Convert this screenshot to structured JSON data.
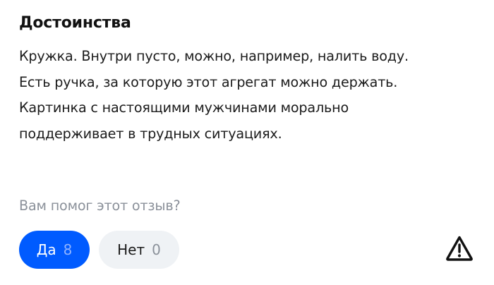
{
  "review": {
    "section_title": "Достоинства",
    "text_lines": [
      "Кружка. Внутри пусто, можно, например, налить воду.",
      "Есть ручка, за которую этот агрегат можно держать.",
      "Картинка с настоящими мужчинами морально",
      "поддерживает в трудных ситуациях."
    ]
  },
  "helpful": {
    "question": "Вам помог этот отзыв?",
    "yes_label": "Да",
    "yes_count": "8",
    "no_label": "Нет",
    "no_count": "0"
  },
  "icons": {
    "report": "warning-triangle-icon"
  },
  "colors": {
    "accent": "#005bff",
    "muted_text": "#8b919a",
    "secondary_button_bg": "#eff2f5"
  }
}
